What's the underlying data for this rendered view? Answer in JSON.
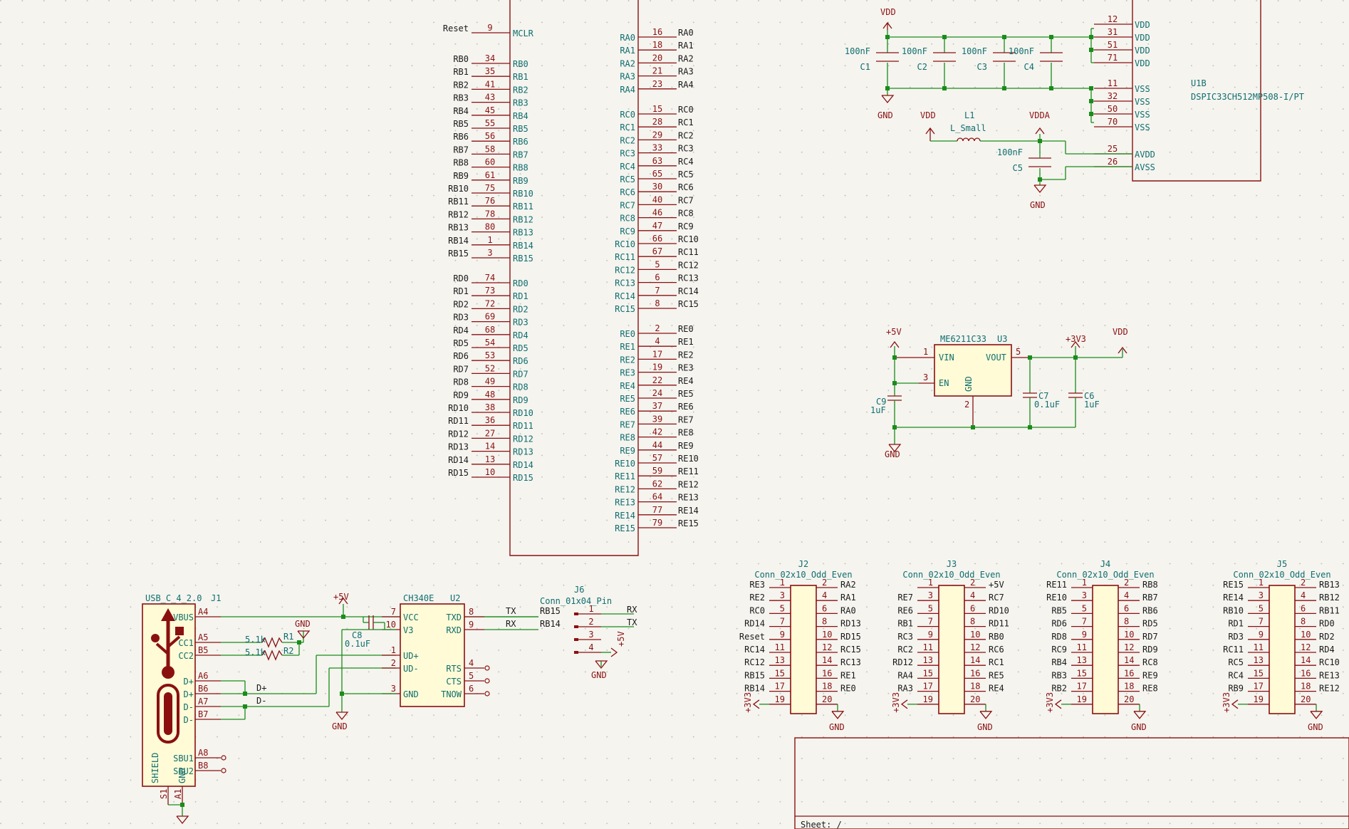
{
  "u1": {
    "left_pins": [
      {
        "net": "Reset",
        "num": "9",
        "name": "MCLR"
      },
      {
        "net": "RB0",
        "num": "34",
        "name": "RB0"
      },
      {
        "net": "RB1",
        "num": "35",
        "name": "RB1"
      },
      {
        "net": "RB2",
        "num": "41",
        "name": "RB2"
      },
      {
        "net": "RB3",
        "num": "43",
        "name": "RB3"
      },
      {
        "net": "RB4",
        "num": "45",
        "name": "RB4"
      },
      {
        "net": "RB5",
        "num": "55",
        "name": "RB5"
      },
      {
        "net": "RB6",
        "num": "56",
        "name": "RB6"
      },
      {
        "net": "RB7",
        "num": "58",
        "name": "RB7"
      },
      {
        "net": "RB8",
        "num": "60",
        "name": "RB8"
      },
      {
        "net": "RB9",
        "num": "61",
        "name": "RB9"
      },
      {
        "net": "RB10",
        "num": "75",
        "name": "RB10"
      },
      {
        "net": "RB11",
        "num": "76",
        "name": "RB11"
      },
      {
        "net": "RB12",
        "num": "78",
        "name": "RB12"
      },
      {
        "net": "RB13",
        "num": "80",
        "name": "RB13"
      },
      {
        "net": "RB14",
        "num": "1",
        "name": "RB14"
      },
      {
        "net": "RB15",
        "num": "3",
        "name": "RB15"
      },
      {
        "net": "RD0",
        "num": "74",
        "name": "RD0"
      },
      {
        "net": "RD1",
        "num": "73",
        "name": "RD1"
      },
      {
        "net": "RD2",
        "num": "72",
        "name": "RD2"
      },
      {
        "net": "RD3",
        "num": "69",
        "name": "RD3"
      },
      {
        "net": "RD4",
        "num": "68",
        "name": "RD4"
      },
      {
        "net": "RD5",
        "num": "54",
        "name": "RD5"
      },
      {
        "net": "RD6",
        "num": "53",
        "name": "RD6"
      },
      {
        "net": "RD7",
        "num": "52",
        "name": "RD7"
      },
      {
        "net": "RD8",
        "num": "49",
        "name": "RD8"
      },
      {
        "net": "RD9",
        "num": "48",
        "name": "RD9"
      },
      {
        "net": "RD10",
        "num": "38",
        "name": "RD10"
      },
      {
        "net": "RD11",
        "num": "36",
        "name": "RD11"
      },
      {
        "net": "RD12",
        "num": "27",
        "name": "RD12"
      },
      {
        "net": "RD13",
        "num": "14",
        "name": "RD13"
      },
      {
        "net": "RD14",
        "num": "13",
        "name": "RD14"
      },
      {
        "net": "RD15",
        "num": "10",
        "name": "RD15"
      }
    ],
    "right_pins": [
      {
        "net": "RA0",
        "num": "16",
        "name": "RA0"
      },
      {
        "net": "RA1",
        "num": "18",
        "name": "RA1"
      },
      {
        "net": "RA2",
        "num": "20",
        "name": "RA2"
      },
      {
        "net": "RA3",
        "num": "21",
        "name": "RA3"
      },
      {
        "net": "RA4",
        "num": "23",
        "name": "RA4"
      },
      {
        "net": "RC0",
        "num": "15",
        "name": "RC0"
      },
      {
        "net": "RC1",
        "num": "28",
        "name": "RC1"
      },
      {
        "net": "RC2",
        "num": "29",
        "name": "RC2"
      },
      {
        "net": "RC3",
        "num": "33",
        "name": "RC3"
      },
      {
        "net": "RC4",
        "num": "63",
        "name": "RC4"
      },
      {
        "net": "RC5",
        "num": "65",
        "name": "RC5"
      },
      {
        "net": "RC6",
        "num": "30",
        "name": "RC6"
      },
      {
        "net": "RC7",
        "num": "40",
        "name": "RC7"
      },
      {
        "net": "RC8",
        "num": "46",
        "name": "RC8"
      },
      {
        "net": "RC9",
        "num": "47",
        "name": "RC9"
      },
      {
        "net": "RC10",
        "num": "66",
        "name": "RC10"
      },
      {
        "net": "RC11",
        "num": "67",
        "name": "RC11"
      },
      {
        "net": "RC12",
        "num": "5",
        "name": "RC12"
      },
      {
        "net": "RC13",
        "num": "6",
        "name": "RC13"
      },
      {
        "net": "RC14",
        "num": "7",
        "name": "RC14"
      },
      {
        "net": "RC15",
        "num": "8",
        "name": "RC15"
      },
      {
        "net": "RE0",
        "num": "2",
        "name": "RE0"
      },
      {
        "net": "RE1",
        "num": "4",
        "name": "RE1"
      },
      {
        "net": "RE2",
        "num": "17",
        "name": "RE2"
      },
      {
        "net": "RE3",
        "num": "19",
        "name": "RE3"
      },
      {
        "net": "RE4",
        "num": "22",
        "name": "RE4"
      },
      {
        "net": "RE5",
        "num": "24",
        "name": "RE5"
      },
      {
        "net": "RE6",
        "num": "37",
        "name": "RE6"
      },
      {
        "net": "RE7",
        "num": "39",
        "name": "RE7"
      },
      {
        "net": "RE8",
        "num": "42",
        "name": "RE8"
      },
      {
        "net": "RE9",
        "num": "44",
        "name": "RE9"
      },
      {
        "net": "RE10",
        "num": "57",
        "name": "RE10"
      },
      {
        "net": "RE11",
        "num": "59",
        "name": "RE11"
      },
      {
        "net": "RE12",
        "num": "62",
        "name": "RE12"
      },
      {
        "net": "RE13",
        "num": "64",
        "name": "RE13"
      },
      {
        "net": "RE14",
        "num": "77",
        "name": "RE14"
      },
      {
        "net": "RE15",
        "num": "79",
        "name": "RE15"
      }
    ]
  },
  "u1b": {
    "ref": "U1B",
    "value": "DSPIC33CH512MP508-I/PT",
    "pins": [
      {
        "num": "12",
        "name": "VDD"
      },
      {
        "num": "31",
        "name": "VDD"
      },
      {
        "num": "51",
        "name": "VDD"
      },
      {
        "num": "71",
        "name": "VDD"
      },
      {
        "num": "11",
        "name": "VSS"
      },
      {
        "num": "32",
        "name": "VSS"
      },
      {
        "num": "50",
        "name": "VSS"
      },
      {
        "num": "70",
        "name": "VSS"
      },
      {
        "num": "25",
        "name": "AVDD"
      },
      {
        "num": "26",
        "name": "AVSS"
      }
    ]
  },
  "decoupling": {
    "caps": [
      {
        "ref": "C1",
        "val": "100nF"
      },
      {
        "ref": "C2",
        "val": "100nF"
      },
      {
        "ref": "C3",
        "val": "100nF"
      },
      {
        "ref": "C4",
        "val": "100nF"
      },
      {
        "ref": "C5",
        "val": "100nF"
      }
    ],
    "vdd": "VDD",
    "gnd": "GND",
    "vdda": "VDDA",
    "l1_ref": "L1",
    "l1_val": "L_Small"
  },
  "regulator": {
    "ref": "U3",
    "value": "ME6211C33",
    "vin": "VIN",
    "en": "EN",
    "vout": "VOUT",
    "gnd": "GND",
    "p1": "1",
    "p3": "3",
    "p5": "5",
    "p2": "2",
    "in_rail": "+5V",
    "out_rail": "+3V3",
    "vdd": "VDD",
    "gnd_label": "GND",
    "c9_ref": "C9",
    "c9_val": "1uF",
    "c7_ref": "C7",
    "c7_val": "0.1uF",
    "c6_ref": "C6",
    "c6_val": "1uF"
  },
  "usb": {
    "j1_ref": "J1",
    "j1_val": "USB_C_4_2.0",
    "pins": [
      {
        "num": "A4",
        "name": "VBUS"
      },
      {
        "num": "A5",
        "name": "CC1"
      },
      {
        "num": "B5",
        "name": "CC2"
      },
      {
        "num": "A6",
        "name": "D+"
      },
      {
        "num": "B6",
        "name": "D+"
      },
      {
        "num": "A7",
        "name": "D-"
      },
      {
        "num": "B7",
        "name": "D-"
      },
      {
        "num": "A8",
        "name": "SBU1"
      },
      {
        "num": "B8",
        "name": "SBU2"
      }
    ],
    "shield": "SHIELD",
    "gnd": "GND",
    "s1": "S1",
    "a1": "A1",
    "r1_ref": "R1",
    "r1_val": "5.1k",
    "r2_ref": "R2",
    "r2_val": "5.1k",
    "vbus_rail": "+5V",
    "gnd_label": "GND",
    "dp_net": "D+",
    "dm_net": "D-"
  },
  "ch340": {
    "ref": "U2",
    "value": "CH340E",
    "pins": [
      {
        "num": "7",
        "name": "VCC"
      },
      {
        "num": "10",
        "name": "V3"
      },
      {
        "num": "1",
        "name": "UD+"
      },
      {
        "num": "2",
        "name": "UD-"
      },
      {
        "num": "3",
        "name": "GND"
      },
      {
        "num": "8",
        "name": "TXD"
      },
      {
        "num": "9",
        "name": "RXD"
      },
      {
        "num": "4",
        "name": "RTS"
      },
      {
        "num": "5",
        "name": "CTS"
      },
      {
        "num": "6",
        "name": "TNOW"
      }
    ],
    "c8_ref": "C8",
    "c8_val": "0.1uF",
    "tx_net": "TX",
    "rx_net": "RX",
    "gnd_label": "GND"
  },
  "j6": {
    "ref": "J6",
    "value": "Conn_01x04_Pin",
    "pins": [
      {
        "num": "1",
        "net": "RX"
      },
      {
        "num": "2",
        "net": "TX"
      },
      {
        "num": "3",
        "net": "+5V"
      },
      {
        "num": "4",
        "net": "GND"
      }
    ],
    "left_nets": [
      "RB15",
      "RB14"
    ]
  },
  "headers": [
    {
      "ref": "J2",
      "value": "Conn_02x10_Odd_Even",
      "left": [
        "RE3",
        "RE2",
        "RC0",
        "RD14",
        "Reset",
        "RC14",
        "RC12",
        "RB15",
        "RB14",
        "+3V3"
      ],
      "right": [
        "RA2",
        "RA1",
        "RA0",
        "RD13",
        "RD15",
        "RC15",
        "RC13",
        "RE1",
        "RE0",
        "GND"
      ]
    },
    {
      "ref": "J3",
      "value": "Conn_02x10_Odd_Even",
      "left": [
        "",
        "RE7",
        "RE6",
        "RB1",
        "RC3",
        "RC2",
        "RD12",
        "RA4",
        "RA3",
        "+3V3"
      ],
      "right": [
        "+5V",
        "RC7",
        "RD10",
        "RD11",
        "RB0",
        "RC6",
        "RC1",
        "RE5",
        "RE4",
        "GND"
      ]
    },
    {
      "ref": "J4",
      "value": "Conn_02x10_Odd_Even",
      "left": [
        "RE11",
        "RE10",
        "RB5",
        "RD6",
        "RD8",
        "RC9",
        "RB4",
        "RB3",
        "RB2",
        "+3V3"
      ],
      "right": [
        "RB8",
        "RB7",
        "RB6",
        "RD5",
        "RD7",
        "RD9",
        "RC8",
        "RE9",
        "RE8",
        "GND"
      ]
    },
    {
      "ref": "J5",
      "value": "Conn_02x10_Odd_Even",
      "left": [
        "RE15",
        "RE14",
        "RB10",
        "RD1",
        "RD3",
        "RC11",
        "RC5",
        "RC4",
        "RB9",
        "+3V3"
      ],
      "right": [
        "RB13",
        "RB12",
        "RB11",
        "RD0",
        "RD2",
        "RD4",
        "RC10",
        "RE13",
        "RE12",
        "GND"
      ]
    }
  ],
  "title_block": {
    "sheet": "Sheet: /"
  },
  "colors": {
    "wire": "#1a8c1a",
    "symbol": "#8a1010",
    "fill": "#fefbd6",
    "pinname": "#0f6e6e",
    "background": "#f5f4ef"
  }
}
